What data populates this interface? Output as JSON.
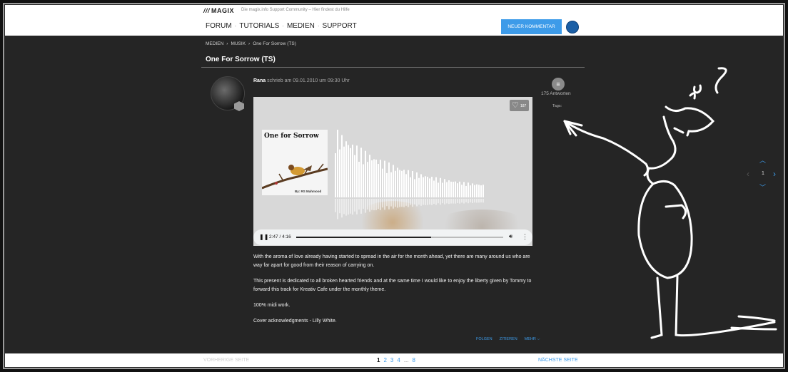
{
  "header": {
    "brand": "MAGIX",
    "tagline": "Die magix.info Support Community – Hier findest du Hilfe",
    "nav": [
      "FORUM",
      "TUTORIALS",
      "MEDIEN",
      "SUPPORT"
    ],
    "new_comment_label": "NEUER KOMMENTAR"
  },
  "breadcrumb": [
    "MEDIEN",
    "MUSIK",
    "One For Sorrow (TS)"
  ],
  "post": {
    "title": "One For Sorrow (TS)",
    "author": "Rana",
    "meta": "schrieb am 09.01.2010 um 09:30 Uhr",
    "cover_title": "One for Sorrow",
    "cover_by": "By: RS Mahmood",
    "likes": "187",
    "player": {
      "time": "2:47 / 4:16",
      "progress": 0.65
    },
    "paragraphs": [
      "With the aroma of love already having started to spread in the air for the month ahead, yet there are many around us who are way far apart for good from their reason of carrying on.",
      "This present is dedicated to all broken hearted friends and at the same time I would like to enjoy the liberty given by Tommy to forward this track for Kreativ Cafe under the monthly theme.",
      "100% midi work.",
      "Cover acknowledgments - Lilly White."
    ],
    "actions": [
      "FOLGEN",
      "ZITIEREN",
      "MEHR ⌵"
    ]
  },
  "sidebar": {
    "replies": "175 Antworten",
    "tags_label": "Tags:"
  },
  "pager_nav": {
    "current": "1"
  },
  "pagination": {
    "prev": "VORHERIGE SEITE",
    "current": "1",
    "pages": [
      "2",
      "3",
      "4"
    ],
    "ellipsis": "...",
    "last": "8",
    "next": "NÄCHSTE SEITE"
  },
  "icons": {
    "menu": "speech-bubble-icon",
    "heart": "heart-icon",
    "play": "pause-icon",
    "volume": "volume-icon"
  },
  "colors": {
    "accent": "#3d9be9",
    "background": "#252525"
  }
}
